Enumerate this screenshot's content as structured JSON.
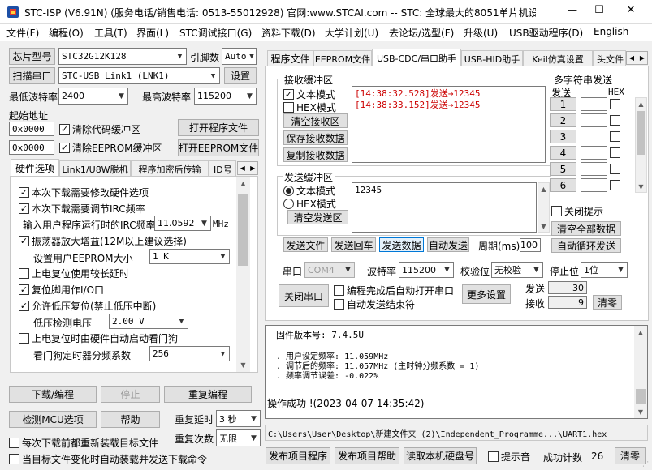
{
  "window": {
    "title": "STC-ISP (V6.91N) (服务电话/销售电话: 0513-55012928) 官网:www.STCAI.com  -- STC: 全球最大的8051单片机设...",
    "controls": {
      "minimize": "—",
      "maximize": "☐",
      "close": "✕"
    }
  },
  "menu": [
    "文件(F)",
    "编程(O)",
    "工具(T)",
    "界面(L)",
    "STC调试接口(G)",
    "资料下载(D)",
    "大学计划(U)",
    "去论坛/选型(F)",
    "升级(U)",
    "USB驱动程序(D)",
    "English"
  ],
  "left": {
    "chip_button": "芯片型号",
    "chip_value": "STC32G12K128",
    "pins_label": "引脚数",
    "pins_value": "Auto",
    "scan_button": "扫描串口",
    "port_value": "STC-USB Link1 (LNK1)",
    "settings_button": "设置",
    "min_baud_label": "最低波特率",
    "min_baud_value": "2400",
    "max_baud_label": "最高波特率",
    "max_baud_value": "115200",
    "start_addr_label": "起始地址",
    "addr1_value": "0x0000",
    "clear_code_label": "清除代码缓冲区",
    "open_program_button": "打开程序文件",
    "addr2_value": "0x0000",
    "clear_eeprom_label": "清除EEPROM缓冲区",
    "open_eeprom_button": "打开EEPROM文件",
    "tabs": [
      "硬件选项",
      "Link1/U8W脱机",
      "程序加密后传输",
      "ID号"
    ],
    "hw": {
      "opt1": "本次下载需要修改硬件选项",
      "opt2": "本次下载需要调节IRC频率",
      "irc_label": "输入用户程序运行时的IRC频率",
      "irc_value": "11.0592",
      "irc_unit": "MHz",
      "opt3": "振荡器放大增益(12M以上建议选择)",
      "eeprom_size_label": "设置用户EEPROM大小",
      "eeprom_size_value": "1    K",
      "opt4": "上电复位使用较长延时",
      "opt5": "复位脚用作I/O口",
      "opt6": "允许低压复位(禁止低压中断)",
      "lv_label": "低压检测电压",
      "lv_value": "2.00 V",
      "opt7": "上电复位时由硬件自动启动看门狗",
      "wdt_label": "看门狗定时器分频系数",
      "wdt_value": "256"
    },
    "download_button": "下载/编程",
    "stop_button": "停止",
    "reprogram_button": "重复编程",
    "check_mcu_button": "检测MCU选项",
    "help_button": "帮助",
    "repeat_delay_label": "重复延时",
    "repeat_delay_value": "3 秒",
    "repeat_count_label": "重复次数",
    "repeat_count_value": "无限",
    "reload_label": "每次下载前都重新装载目标文件",
    "auto_load_label": "当目标文件变化时自动装载并发送下载命令"
  },
  "right": {
    "tabs": [
      "程序文件",
      "EEPROM文件",
      "USB-CDC/串口助手",
      "USB-HID助手",
      "Keil仿真设置",
      "头文件"
    ],
    "recv": {
      "title": "接收缓冲区",
      "text_mode": "文本模式",
      "hex_mode": "HEX模式",
      "clear": "清空接收区",
      "save": "保存接收数据",
      "copy": "复制接收数据",
      "lines": [
        "[14:38:32.528]发送→12345",
        "[14:38:33.152]发送→12345"
      ]
    },
    "multi": {
      "title": "多字符串发送",
      "col_send": "发送",
      "col_hex": "HEX",
      "rows": [
        "1",
        "2",
        "3",
        "4",
        "5",
        "6"
      ],
      "close_hint": "关闭提示",
      "clear_all": "清空全部数据",
      "auto_loop": "自动循环发送"
    },
    "send": {
      "title": "发送缓冲区",
      "text_mode": "文本模式",
      "hex_mode": "HEX模式",
      "clear": "清空发送区",
      "content": "12345"
    },
    "actions": {
      "send_file": "发送文件",
      "send_cr": "发送回车",
      "send_data": "发送数据",
      "auto_send": "自动发送",
      "period_label": "周期(ms)",
      "period_value": "100"
    },
    "serial": {
      "port_label": "串口",
      "port_value": "COM4",
      "baud_label": "波特率",
      "baud_value": "115200",
      "parity_label": "校验位",
      "parity_value": "无校验",
      "stop_label": "停止位",
      "stop_value": "1位",
      "close_button": "关闭串口",
      "auto_open_label": "编程完成后自动打开串口",
      "auto_end_label": "自动发送结束符",
      "more_settings": "更多设置",
      "send_label": "发送",
      "send_count": "30",
      "recv_label": "接收",
      "recv_count": "9",
      "clear_count": "清零"
    },
    "log": {
      "firmware": "固件版本号: 7.4.5U",
      "lines": [
        ". 用户设定频率: 11.059MHz",
        ". 调节后的频率: 11.057MHz (主时钟分频系数 = 1)",
        ". 频率调节误差: -0.022%"
      ],
      "success": "操作成功 !(2023-04-07 14:35:42)"
    },
    "file_path": "C:\\Users\\User\\Desktop\\新建文件夹 (2)\\Independent_Programme...\\UART1.hex",
    "bottom": {
      "publish_program": "发布项目程序",
      "publish_help": "发布项目帮助",
      "read_disk": "读取本机硬盘号",
      "beep_label": "提示音",
      "success_count_label": "成功计数",
      "success_count": "26",
      "clear": "清零"
    }
  },
  "colors": {
    "log_red": "#cc0000",
    "accent": "#0078d7"
  }
}
